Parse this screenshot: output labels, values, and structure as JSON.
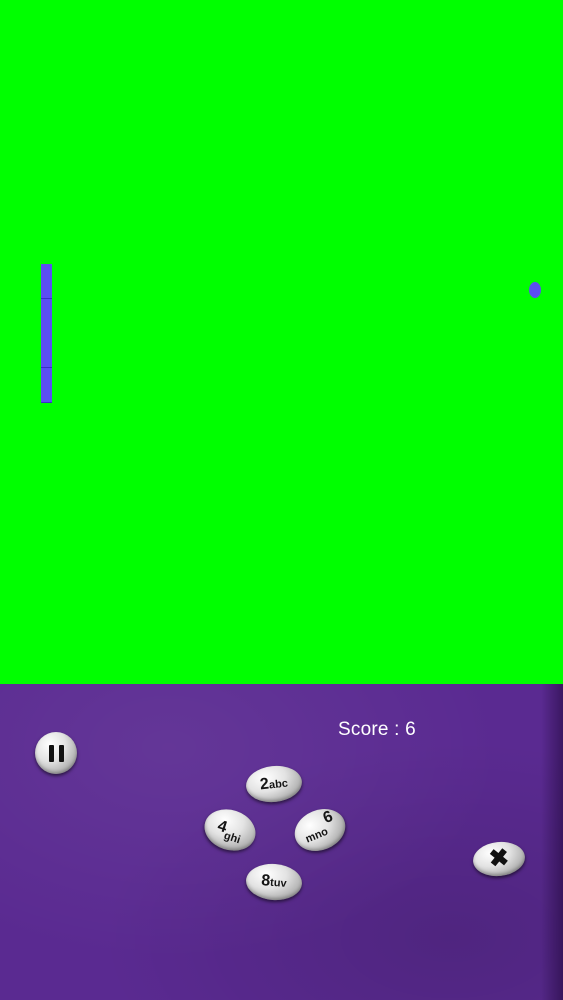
{
  "game": {
    "snake_length": 8,
    "colors": {
      "playfield": "#00ff00",
      "snake": "#5b4ef2",
      "food": "#5b4ef2",
      "control_panel": "#5a2a91",
      "score_text": "#ffffff"
    }
  },
  "hud": {
    "score_label": "Score : 6"
  },
  "controls": {
    "pause_icon": "pause-icon",
    "close_icon": "close-icon",
    "close_symbol": "✖",
    "keys": {
      "up": {
        "digit": "2",
        "letters": "abc"
      },
      "left": {
        "digit": "4",
        "letters": "ghi"
      },
      "right": {
        "digit": "6",
        "letters": "mno"
      },
      "down": {
        "digit": "8",
        "letters": "tuv"
      }
    }
  }
}
